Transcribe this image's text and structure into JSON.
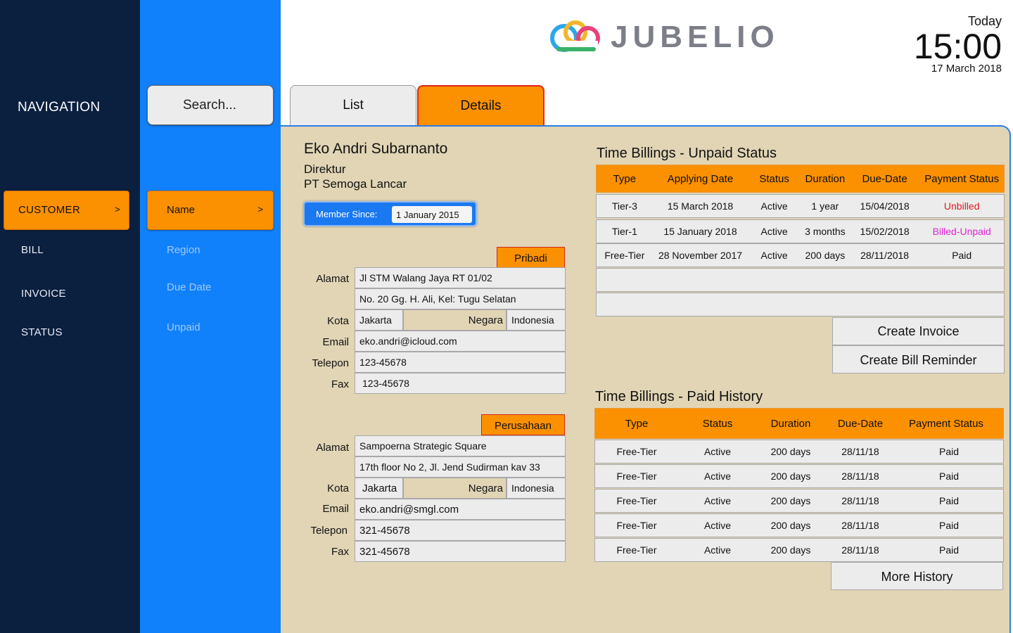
{
  "nav": {
    "title": "NAVIGATION",
    "items": [
      {
        "label": "CUSTOMER",
        "chevron": ">"
      },
      {
        "label": "BILL"
      },
      {
        "label": "INVOICE"
      },
      {
        "label": "STATUS"
      }
    ]
  },
  "filter": {
    "search_placeholder": "Search...",
    "items": [
      {
        "label": "Name",
        "chevron": ">"
      },
      {
        "label": "Region"
      },
      {
        "label": "Due Date"
      },
      {
        "label": "Unpaid"
      }
    ]
  },
  "header": {
    "logo_text": "JUBELIO",
    "clock_label": "Today",
    "time": "15:00",
    "date": "17 March 2018"
  },
  "tabs": [
    {
      "label": "List"
    },
    {
      "label": "Details"
    }
  ],
  "customer": {
    "name": "Eko Andri Subarnanto",
    "title": "Direktur",
    "company": "PT Semoga Lancar",
    "member_since_label": "Member Since:",
    "member_since_value": "1 January 2015"
  },
  "pribadi": {
    "tag": "Pribadi",
    "alamat_label": "Alamat",
    "alamat_1": "Jl STM Walang Jaya RT 01/02",
    "alamat_2": "No. 20 Gg. H. Ali, Kel: Tugu Selatan",
    "kota_label": "Kota",
    "kota": "Jakarta",
    "negara_label": "Negara",
    "negara": "Indonesia",
    "email_label": "Email",
    "email": "eko.andri@icloud.com",
    "telepon_label": "Telepon",
    "telepon": "123-45678",
    "fax_label": "Fax",
    "fax": "123-45678"
  },
  "perusahaan": {
    "tag": "Perusahaan",
    "alamat_label": "Alamat",
    "alamat_1": "Sampoerna Strategic Square",
    "alamat_2": "17th floor No 2, Jl. Jend Sudirman kav 33",
    "kota_label": "Kota",
    "kota": "Jakarta",
    "negara_label": "Negara",
    "negara": "Indonesia",
    "email_label": "Email",
    "email": "eko.andri@smgl.com",
    "telepon_label": "Telepon",
    "telepon": "321-45678",
    "fax_label": "Fax",
    "fax": "321-45678"
  },
  "unpaid": {
    "title": "Time Billings - Unpaid Status",
    "headers": [
      "Type",
      "Applying Date",
      "Status",
      "Duration",
      "Due-Date",
      "Payment Status"
    ],
    "rows": [
      {
        "type": "Tier-3",
        "applying": "15 March 2018",
        "status": "Active",
        "duration": "1 year",
        "due": "15/04/2018",
        "payment": "Unbilled",
        "color": "#e3171d"
      },
      {
        "type": "Tier-1",
        "applying": "15 January 2018",
        "status": "Active",
        "duration": "3 months",
        "due": "15/02/2018",
        "payment": "Billed-Unpaid",
        "color": "#e022d6"
      },
      {
        "type": "Free-Tier",
        "applying": "28 November 2017",
        "status": "Active",
        "duration": "200 days",
        "due": "28/11/2018",
        "payment": "Paid",
        "color": "#111111"
      }
    ],
    "create_invoice": "Create Invoice",
    "create_reminder": "Create Bill Reminder"
  },
  "paid": {
    "title": "Time Billings - Paid History",
    "headers": [
      "Type",
      "Status",
      "Duration",
      "Due-Date",
      "Payment Status"
    ],
    "rows": [
      {
        "type": "Free-Tier",
        "status": "Active",
        "duration": "200 days",
        "due": "28/11/18",
        "payment": "Paid"
      },
      {
        "type": "Free-Tier",
        "status": "Active",
        "duration": "200 days",
        "due": "28/11/18",
        "payment": "Paid"
      },
      {
        "type": "Free-Tier",
        "status": "Active",
        "duration": "200 days",
        "due": "28/11/18",
        "payment": "Paid"
      },
      {
        "type": "Free-Tier",
        "status": "Active",
        "duration": "200 days",
        "due": "28/11/18",
        "payment": "Paid"
      },
      {
        "type": "Free-Tier",
        "status": "Active",
        "duration": "200 days",
        "due": "28/11/18",
        "payment": "Paid"
      }
    ],
    "more": "More History"
  },
  "colors": {
    "nav_bg": "#0b1f3f",
    "filter_bg": "#1181fb",
    "accent": "#fb9000",
    "panel_bg": "#e1d5b5"
  }
}
